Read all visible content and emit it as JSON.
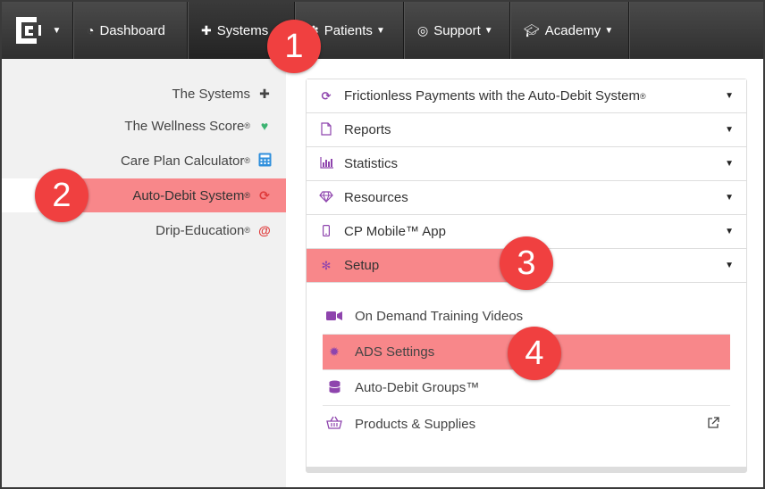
{
  "topnav": {
    "items": [
      {
        "label": "Dashboard",
        "icon": "dashboard-icon"
      },
      {
        "label": "Systems",
        "icon": "puzzle-icon"
      },
      {
        "label": "Patients",
        "icon": "users-icon"
      },
      {
        "label": "Support",
        "icon": "lifebuoy-icon"
      },
      {
        "label": "Academy",
        "icon": "graduation-cap-icon"
      }
    ]
  },
  "sidebar": {
    "items": [
      {
        "label": "The Systems",
        "icon": "puzzle-icon",
        "icon_color": "#444444"
      },
      {
        "label": "The Wellness Score",
        "reg": "®",
        "icon": "heartbeat-icon",
        "icon_color": "#3cb371"
      },
      {
        "label": "Care Plan Calculator",
        "reg": "®",
        "icon": "calculator-icon",
        "icon_color": "#2f8fdc"
      },
      {
        "label": "Auto-Debit System",
        "reg": "®",
        "icon": "refresh-icon",
        "icon_color": "#e03c3c"
      },
      {
        "label": "Drip-Education",
        "reg": "®",
        "icon": "at-sign-icon",
        "icon_color": "#e03c3c"
      }
    ]
  },
  "accordion": {
    "rows": [
      {
        "label": "Frictionless Payments with the Auto-Debit System",
        "reg": "®",
        "icon": "refresh-icon"
      },
      {
        "label": "Reports",
        "icon": "file-icon"
      },
      {
        "label": "Statistics",
        "icon": "bar-chart-icon"
      },
      {
        "label": "Resources",
        "icon": "diamond-icon"
      },
      {
        "label": "CP Mobile™ App",
        "icon": "mobile-icon"
      },
      {
        "label": "Setup",
        "icon": "cogs-icon"
      }
    ],
    "setup_items": [
      {
        "label": "On Demand Training Videos",
        "icon": "video-camera-icon"
      },
      {
        "label": "ADS Settings",
        "icon": "gear-icon"
      },
      {
        "label": "Auto-Debit Groups™",
        "icon": "database-icon"
      },
      {
        "label": "Products & Supplies",
        "icon": "shopping-basket-icon"
      }
    ]
  },
  "callouts": [
    "1",
    "2",
    "3",
    "4"
  ],
  "colors": {
    "accent_purple": "#8e44ad",
    "highlight": "#f8878a",
    "callout": "#f04040",
    "nav_bg": "#3a3a3a"
  }
}
